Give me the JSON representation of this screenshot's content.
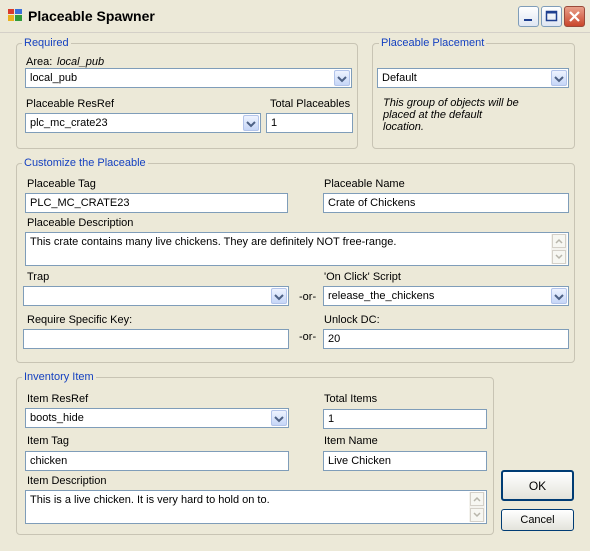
{
  "window": {
    "title": "Placeable Spawner",
    "icon": "app-icon"
  },
  "required": {
    "legend": "Required",
    "area_label": "Area:",
    "area_value_label": "local_pub",
    "area_select": "local_pub",
    "resref_label": "Placeable ResRef",
    "resref_select": "plc_mc_crate23",
    "total_label": "Total Placeables",
    "total_value": "1"
  },
  "placement": {
    "legend": "Placeable Placement",
    "select": "Default",
    "note": "This group of objects will be placed at the default location."
  },
  "customize": {
    "legend": "Customize the Placeable",
    "tag_label": "Placeable Tag",
    "tag_value": "PLC_MC_CRATE23",
    "name_label": "Placeable Name",
    "name_value": "Crate of Chickens",
    "desc_label": "Placeable Description",
    "desc_value": "This crate contains many live chickens.  They are definitely NOT free-range.",
    "trap_label": "Trap",
    "trap_value": "",
    "or1": "-or-",
    "onclick_label": "'On Click' Script",
    "onclick_value": "release_the_chickens",
    "key_label": "Require Specific Key:",
    "key_value": "",
    "or2": "-or-",
    "unlock_label": "Unlock DC:",
    "unlock_value": "20"
  },
  "inventory": {
    "legend": "Inventory Item",
    "resref_label": "Item ResRef",
    "resref_value": "boots_hide",
    "total_label": "Total Items",
    "total_value": "1",
    "tag_label": "Item Tag",
    "tag_value": "chicken",
    "name_label": "Item Name",
    "name_value": "Live Chicken",
    "desc_label": "Item Description",
    "desc_value": "This is a live chicken.  It is very hard to hold on to."
  },
  "buttons": {
    "ok": "OK",
    "cancel": "Cancel"
  },
  "colors": {
    "legend": "#1541c0",
    "field_border": "#7f9db9",
    "background": "#ece9d8"
  }
}
